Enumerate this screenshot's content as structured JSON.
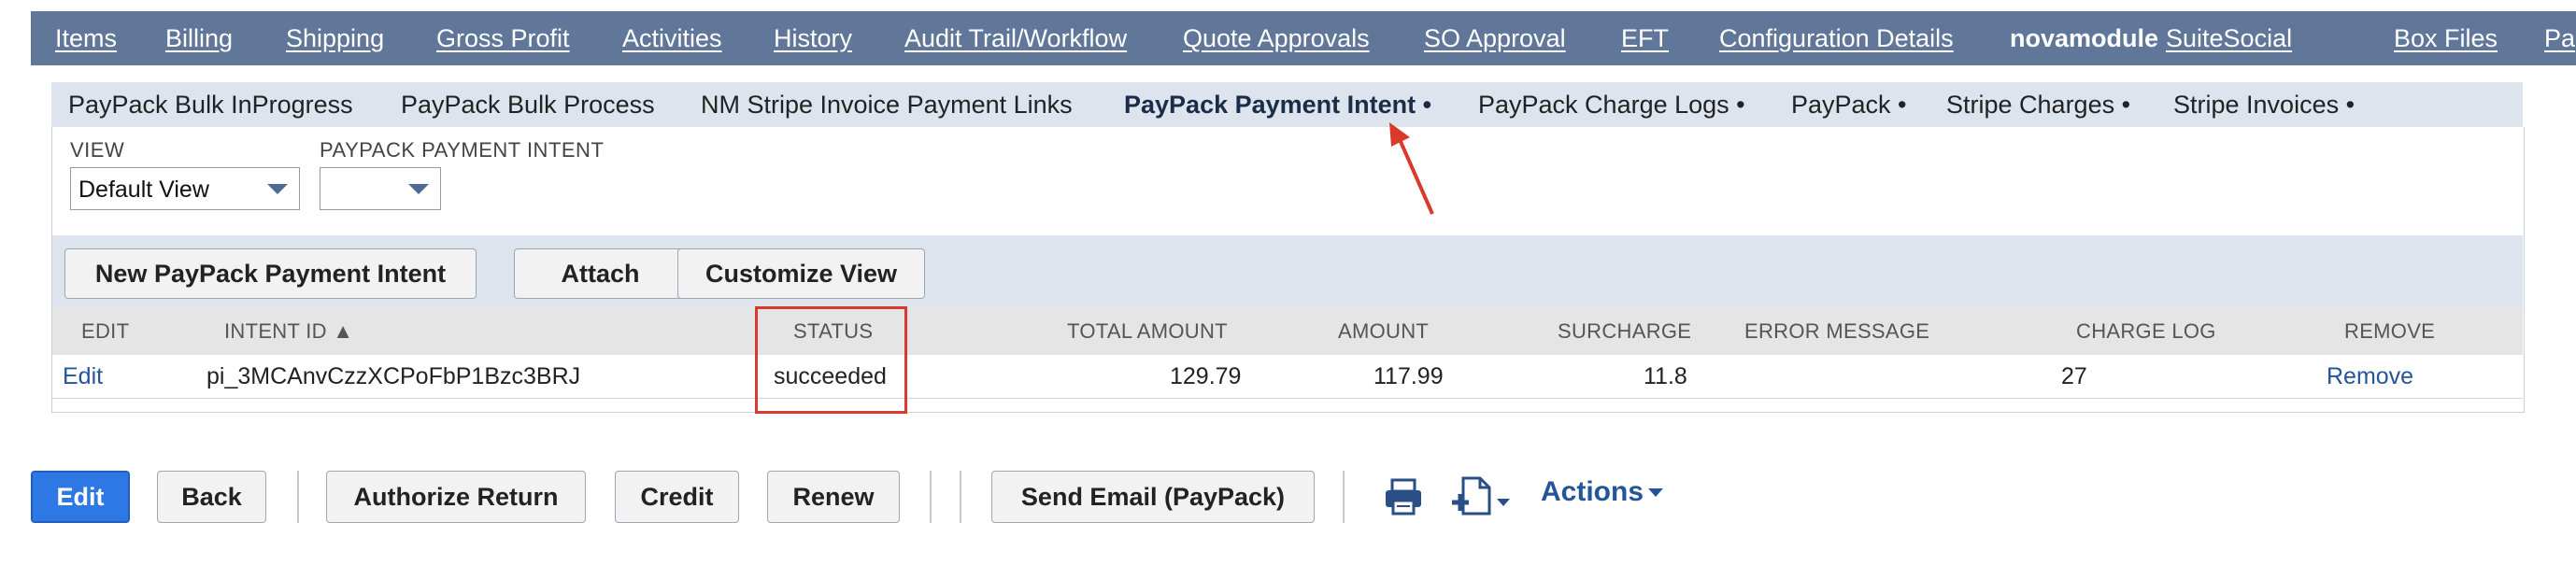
{
  "topnav": {
    "items": [
      "Items",
      "Billing",
      "Shipping",
      "Gross Profit",
      "Activities",
      "History",
      "Audit Trail/Workflow",
      "Quote Approvals",
      "SO Approval",
      "EFT",
      "Configuration Details",
      "novamodule",
      "SuiteSocial",
      "Box Files",
      "Pa"
    ],
    "active": "novamodule"
  },
  "subtabs": {
    "items": [
      "PayPack Bulk InProgress",
      "PayPack Bulk Process",
      "NM Stripe Invoice Payment Links",
      "PayPack Payment Intent •",
      "PayPack Charge Logs •",
      "PayPack •",
      "Stripe Charges •",
      "Stripe Invoices •"
    ],
    "active": "PayPack Payment Intent •"
  },
  "filters": {
    "view_label": "VIEW",
    "view_value": "Default View",
    "intent_label": "PAYPACK PAYMENT INTENT",
    "intent_value": ""
  },
  "sublist_buttons": {
    "new": "New PayPack Payment Intent",
    "attach": "Attach",
    "customize": "Customize View"
  },
  "table": {
    "columns": [
      "EDIT",
      "INTENT ID ▲",
      "STATUS",
      "TOTAL AMOUNT",
      "AMOUNT",
      "SURCHARGE",
      "ERROR MESSAGE",
      "CHARGE LOG",
      "REMOVE"
    ],
    "rows": [
      {
        "edit": "Edit",
        "intent_id": "pi_3MCAnvCzzXCPoFbP1Bzc3BRJ",
        "status": "succeeded",
        "total_amount": "129.79",
        "amount": "117.99",
        "surcharge": "11.8",
        "error_message": "",
        "charge_log": "27",
        "remove": "Remove"
      }
    ]
  },
  "bottom_buttons": {
    "edit": "Edit",
    "back": "Back",
    "authorize_return": "Authorize Return",
    "credit": "Credit",
    "renew": "Renew",
    "send_email": "Send Email (PayPack)",
    "actions": "Actions"
  },
  "icons": {
    "print": "printer-icon",
    "new_doc": "document-plus-icon",
    "dropdown": "chevron-down-icon"
  },
  "colors": {
    "nav_bg": "#607799",
    "subtab_bg": "#dde4ee",
    "primary": "#2e78e6",
    "annotation": "#d93a2b",
    "link": "#255599"
  }
}
